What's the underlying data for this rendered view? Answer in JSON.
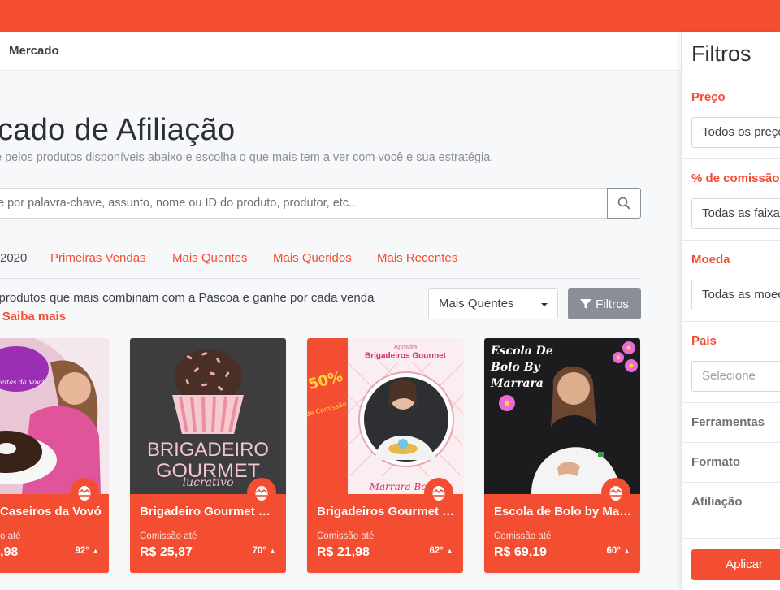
{
  "breadcrumb": {
    "label": "Mercado"
  },
  "header": {
    "title": "rcado de Afiliação",
    "subtitle": "e pelos produtos disponíveis abaixo e escolha o que mais tem a ver com você e sua estratégia."
  },
  "search": {
    "placeholder": "e por palavra-chave, assunto, nome ou ID do produto, produtor, etc...",
    "icon": "search-icon"
  },
  "tabs": [
    {
      "label": "2020",
      "active": true
    },
    {
      "label": "Primeiras Vendas",
      "active": false
    },
    {
      "label": "Mais Quentes",
      "active": false
    },
    {
      "label": "Mais Queridos",
      "active": false
    },
    {
      "label": "Mais Recentes",
      "active": false
    }
  ],
  "promo": {
    "line1": "e produtos que mais combinam com a Páscoa e ganhe por cada venda",
    "line2_prefix": "a.",
    "link": "Saiba mais"
  },
  "sort": {
    "selected": "Mais Quentes"
  },
  "filter_button": {
    "label": "Filtros"
  },
  "products": [
    {
      "name": "Caseiros da Vovó",
      "commission_label": "o até",
      "price": ",98",
      "temperature": "92°",
      "image_caption": "Receitas da Vovó"
    },
    {
      "name": "Brigadeiro Gourmet Lucrativo",
      "commission_label": "Comissão até",
      "price": "R$ 25,87",
      "temperature": "70°",
      "image_text_1": "BRIGADEIRO",
      "image_text_2": "GOURMET",
      "image_text_3": "lucrativo"
    },
    {
      "name": "Brigadeiros Gourmet Marrara",
      "commission_label": "Comissão até",
      "price": "R$ 21,98",
      "temperature": "62°",
      "image_top_small": "Apostila",
      "image_top": "Brigadeiros Gourmet",
      "image_badge_pct": "50%",
      "image_badge_sub": "de Comissão",
      "image_bottom": "Marrara Borto"
    },
    {
      "name": "Escola de Bolo by Marrara",
      "commission_label": "Comissão até",
      "price": "R$ 69,19",
      "temperature": "60°",
      "image_title_1": "Escola De",
      "image_title_2": "Bolo By",
      "image_title_3": "Marrara"
    }
  ],
  "sidebar": {
    "title": "Filtros",
    "sections": [
      {
        "label": "Preço",
        "value": "Todos os preços"
      },
      {
        "label": "% de comissão",
        "value": "Todas as faixas"
      },
      {
        "label": "Moeda",
        "value": "Todas as moedas"
      },
      {
        "label": "País",
        "placeholder": "Selecione"
      }
    ],
    "collapsed": [
      "Ferramentas",
      "Formato",
      "Afiliação"
    ],
    "apply_label": "Aplicar"
  },
  "colors": {
    "accent": "#f44e32",
    "grey_button": "#8a8f96"
  }
}
